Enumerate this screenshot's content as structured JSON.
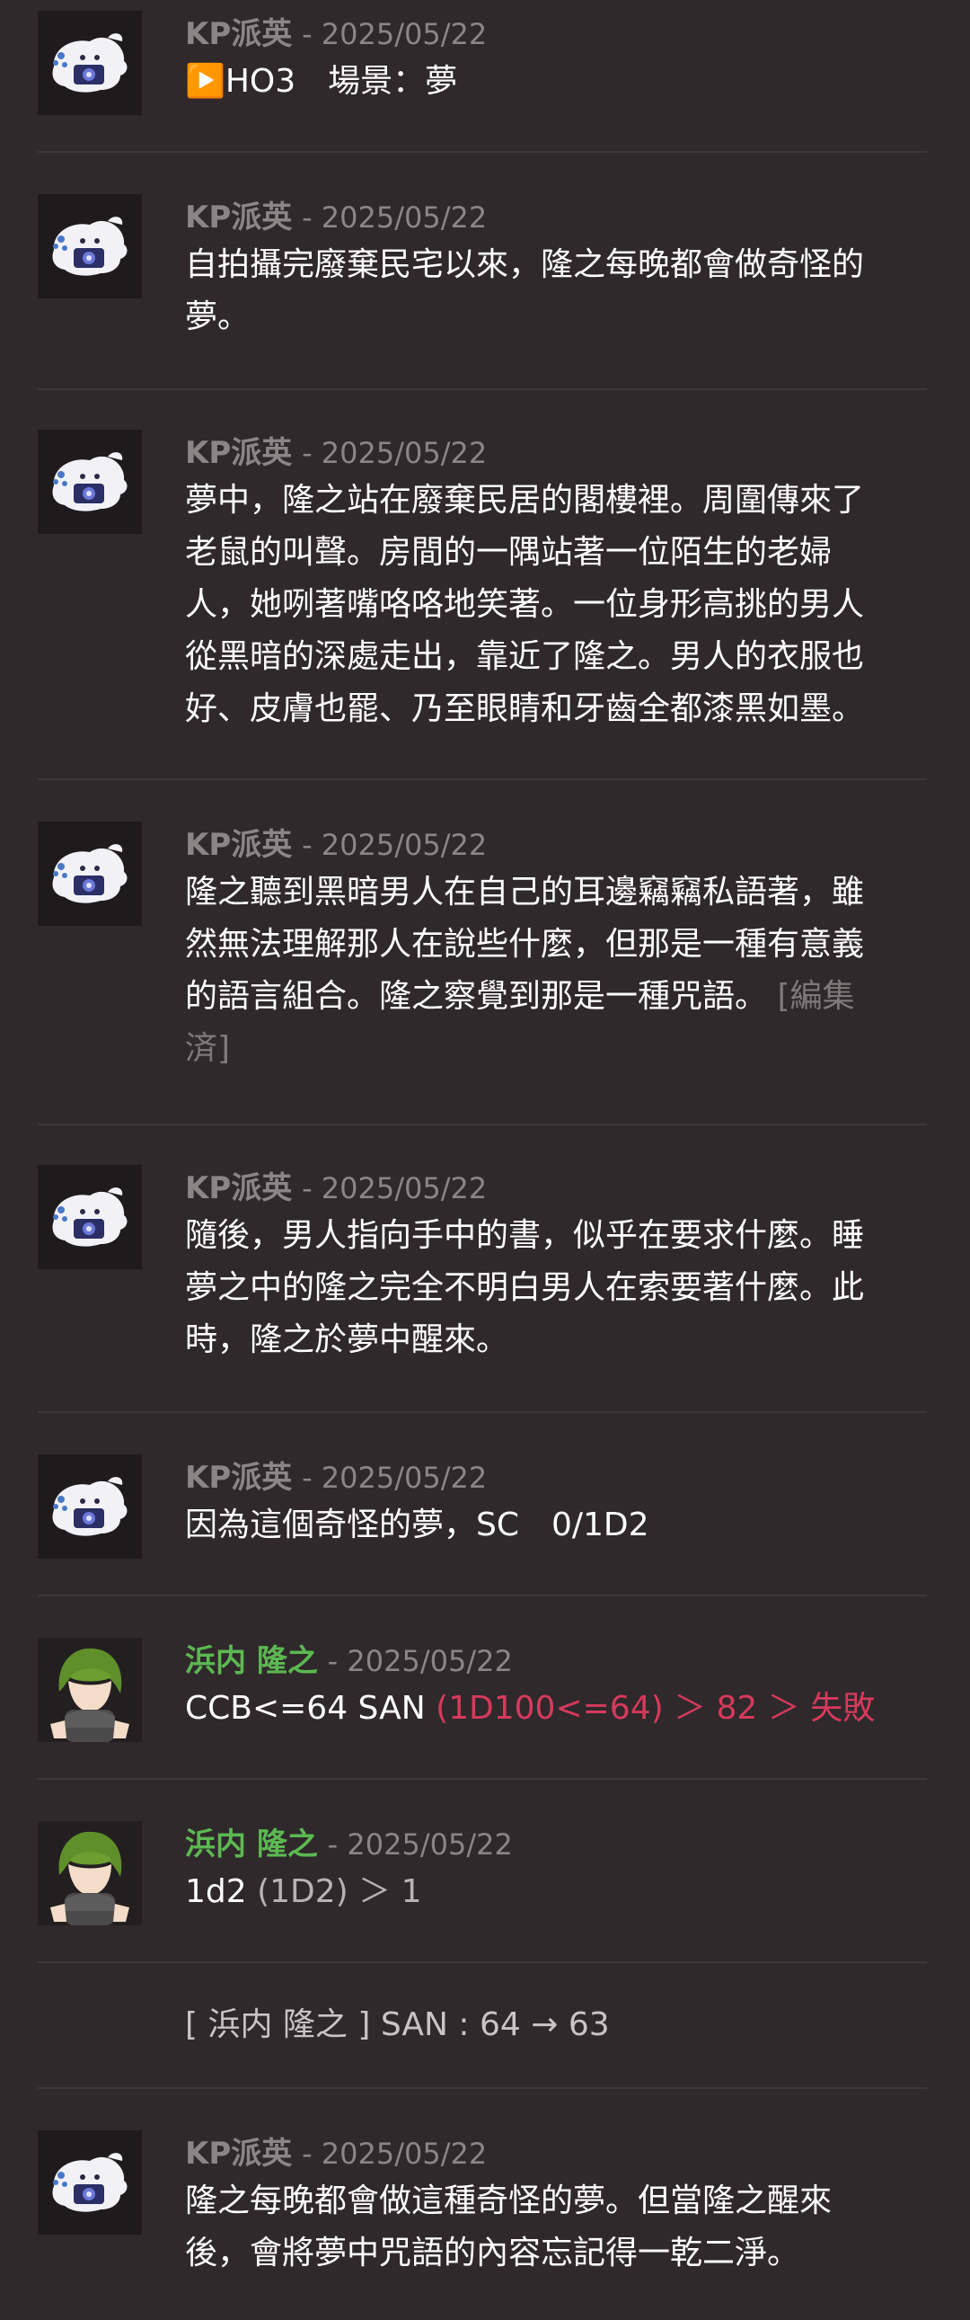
{
  "messages": [
    {
      "name": "KP派英",
      "date": "2025/05/22",
      "avatar": "ghost-avatar",
      "lines": [
        "▶️HO3　場景：夢"
      ]
    },
    {
      "name": "KP派英",
      "date": "2025/05/22",
      "avatar": "ghost-avatar",
      "lines": [
        "自拍攝完廢棄民宅以來，隆之每晚都會做奇怪的",
        "夢。"
      ]
    },
    {
      "name": "KP派英",
      "date": "2025/05/22",
      "avatar": "ghost-avatar",
      "lines": [
        "夢中，隆之站在廢棄民居的閣樓裡。周圍傳來了",
        "老鼠的叫聲。房間的一隅站著一位陌生的老婦",
        "人，她咧著嘴咯咯地笑著。一位身形高挑的男人",
        "從黑暗的深處走出，靠近了隆之。男人的衣服也",
        "好、皮膚也罷、乃至眼睛和牙齒全都漆黑如墨。"
      ]
    },
    {
      "name": "KP派英",
      "date": "2025/05/22",
      "avatar": "ghost-avatar",
      "lines": [
        "隆之聽到黑暗男人在自己的耳邊竊竊私語著，雖",
        "然無法理解那人在說些什麼，但那是一種有意義",
        "的語言組合。隆之察覺到那是一種咒語。"
      ],
      "edited_a": "[編集",
      "edited_b": "済]"
    },
    {
      "name": "KP派英",
      "date": "2025/05/22",
      "avatar": "ghost-avatar",
      "lines": [
        "隨後，男人指向手中的書，似乎在要求什麼。睡",
        "夢之中的隆之完全不明白男人在索要著什麼。此",
        "時，隆之於夢中醒來。"
      ]
    },
    {
      "name": "KP派英",
      "date": "2025/05/22",
      "avatar": "ghost-avatar",
      "lines": [
        "因為這個奇怪的夢，SC　0/1D2"
      ]
    },
    {
      "name": "浜内 隆之",
      "date": "2025/05/22",
      "avatar": "green-hair-character-avatar",
      "text_main": "CCB<=64 SAN ",
      "text_roll": "(1D100<=64) ＞ 82 ＞ 失敗"
    },
    {
      "name": "浜内 隆之",
      "date": "2025/05/22",
      "avatar": "green-hair-character-avatar",
      "text_main": "1d2 ",
      "text_muted": "(1D2)",
      "text_result": " ＞ 1"
    },
    {
      "system": "[ 浜内 隆之 ] SAN : 64 → 63"
    },
    {
      "name": "KP派英",
      "date": "2025/05/22",
      "avatar": "ghost-avatar",
      "lines": [
        "隆之每晚都會做這種奇怪的夢。但當隆之醒來",
        "後，會將夢中咒語的內容忘記得一乾二淨。"
      ]
    }
  ],
  "colors": {
    "background": "#2f292b",
    "kp_name": "#8b8586",
    "pc_name": "#5cb852",
    "roll_fail": "#d63a5c",
    "divider": "#3d3739"
  }
}
